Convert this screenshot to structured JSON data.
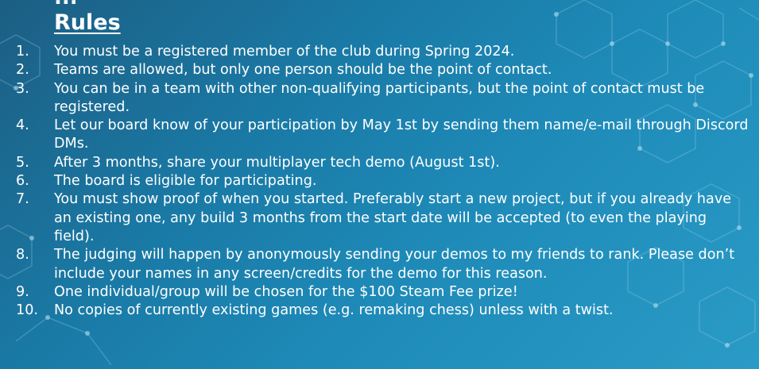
{
  "slide": {
    "cut_off_title": "...",
    "heading": "Rules",
    "rules": [
      {
        "number": "1.",
        "text": "You must be a registered member of the club during Spring 2024."
      },
      {
        "number": "2.",
        "text": "Teams are allowed, but only one person should be the point of contact."
      },
      {
        "number": "3.",
        "text": "You can be in a team with other non-qualifying participants, but the point of contact must be registered."
      },
      {
        "number": "4.",
        "text": "Let our board know of your participation by May 1st by sending them name/e-mail through Discord DMs."
      },
      {
        "number": "5.",
        "text": "After 3 months, share your multiplayer tech demo (August 1st)."
      },
      {
        "number": "6.",
        "text": "The board is eligible for participating."
      },
      {
        "number": "7.",
        "text": "You must show proof of when you started. Preferably start a new project, but if you already have an existing one, any build 3 months from the start date will be accepted (to even the playing field)."
      },
      {
        "number": "8.",
        "text": "The judging will happen by anonymously sending your demos to my friends to rank. Please don’t include your names in any screen/credits for the demo for this reason."
      },
      {
        "number": "9.",
        "text": "One individual/group will be chosen for the $100 Steam Fee prize!"
      },
      {
        "number": "10.",
        "text": "No copies of currently existing games (e.g. remaking chess) unless with a twist."
      }
    ]
  },
  "colors": {
    "background_start": "#1c5e83",
    "background_end": "#2a9bc6",
    "text": "#ffffff"
  },
  "decoration": {
    "pattern": "hexagon-network"
  }
}
